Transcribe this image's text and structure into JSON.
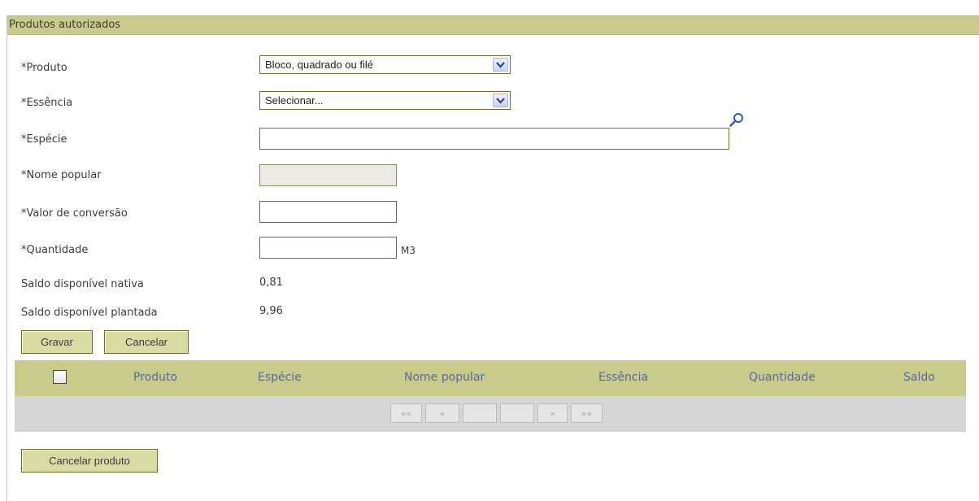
{
  "panel": {
    "title": "Produtos autorizados"
  },
  "form": {
    "produto": {
      "label": "*Produto",
      "value": "Bloco, quadrado ou filé"
    },
    "essencia": {
      "label": "*Essência",
      "value": "Selecionar..."
    },
    "especie": {
      "label": "*Espécie",
      "value": ""
    },
    "nome_popular": {
      "label": "*Nome popular",
      "value": ""
    },
    "valor_conversao": {
      "label": "*Valor de conversão",
      "value": ""
    },
    "quantidade": {
      "label": "*Quantidade",
      "value": "",
      "unit": "M3"
    },
    "saldo_nativa": {
      "label": "Saldo disponível nativa",
      "value": "0,81"
    },
    "saldo_plantada": {
      "label": "Saldo disponível plantada",
      "value": "9,96"
    }
  },
  "buttons": {
    "gravar": "Gravar",
    "cancelar": "Cancelar",
    "cancelar_produto": "Cancelar produto"
  },
  "grid": {
    "columns": [
      "Produto",
      "Espécie",
      "Nome popular",
      "Essência",
      "Quantidade",
      "Saldo"
    ],
    "pager": {
      "first": "««",
      "prev": "«",
      "next": "»",
      "last": "»»"
    }
  },
  "colors": {
    "header": "#c9cb8a",
    "border": "#6f6f2a",
    "column_text": "#5a6aa0"
  },
  "icons": {
    "search": "magnifier-icon",
    "dropdown": "chevron-down-icon"
  }
}
